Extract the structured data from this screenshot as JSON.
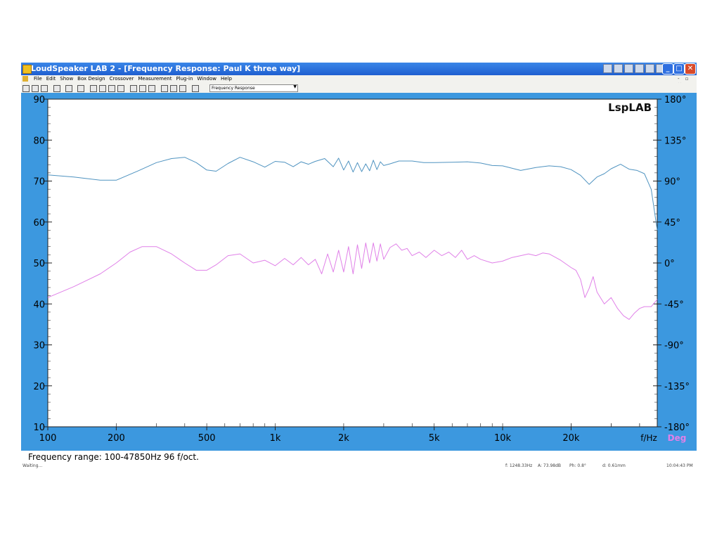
{
  "window": {
    "title": "LoudSpeaker LAB 2 - [Frequency Response: Paul K three way]",
    "controls": [
      "minimize-icon",
      "maximize-icon",
      "close-icon"
    ]
  },
  "menu": [
    "File",
    "Edit",
    "Show",
    "Box Design",
    "Crossover",
    "Measurement",
    "Plug-in",
    "Window",
    "Help"
  ],
  "toolbar": {
    "view_select": "Frequency Response"
  },
  "chart": {
    "watermark": "LspLAB",
    "xlabel": "f/Hz",
    "phase_unit_label": "Deg",
    "colors": {
      "frame": "#3c98df",
      "spl": "#4f93c0",
      "phase": "#e080e8"
    }
  },
  "chart_data": {
    "type": "line",
    "x_scale": "log",
    "xlim": [
      100,
      47850
    ],
    "x_ticks": [
      100,
      200,
      500,
      1000,
      2000,
      5000,
      10000,
      20000
    ],
    "x_tick_labels": [
      "100",
      "200",
      "500",
      "1k",
      "2k",
      "5k",
      "10k",
      "20k"
    ],
    "ylim": [
      10,
      90
    ],
    "y_ticks": [
      90,
      80,
      70,
      60,
      50,
      40,
      30,
      20,
      10
    ],
    "y_tick_labels": [
      "90",
      "80",
      "70",
      "60",
      "50",
      "40",
      "30",
      "20",
      "10"
    ],
    "y2lim": [
      -180,
      180
    ],
    "y2_ticks": [
      180,
      135,
      90,
      45,
      0,
      -45,
      -90,
      -135,
      -180
    ],
    "y2_tick_labels": [
      "180°",
      "135°",
      "90°",
      "45°",
      "0°",
      "-45°",
      "-90°",
      "-135°",
      "-180°"
    ],
    "series": [
      {
        "axis": "left",
        "x": [
          100,
          130,
          170,
          200,
          250,
          300,
          350,
          400,
          450,
          500,
          550,
          620,
          700,
          800,
          900,
          1000,
          1100,
          1200,
          1300,
          1400,
          1500,
          1650,
          1800,
          1900,
          2000,
          2100,
          2200,
          2300,
          2400,
          2500,
          2600,
          2700,
          2800,
          2900,
          3000,
          3200,
          3500,
          4000,
          4500,
          5000,
          6000,
          7000,
          8000,
          9000,
          10000,
          12000,
          14000,
          16000,
          18000,
          20000,
          22000,
          24000,
          26000,
          28000,
          30000,
          33000,
          36000,
          39000,
          42000,
          45000,
          47850
        ],
        "y": [
          71.5,
          71,
          70.2,
          70.2,
          72.5,
          74.5,
          75.5,
          75.8,
          74.5,
          72.7,
          72.4,
          74.3,
          75.8,
          74.7,
          73.4,
          74.8,
          74.6,
          73.5,
          74.7,
          74.1,
          74.8,
          75.5,
          73.5,
          75.6,
          72.7,
          74.9,
          72.2,
          74.5,
          72.3,
          74.2,
          72.5,
          75.1,
          72.8,
          74.7,
          73.8,
          74.2,
          74.9,
          74.9,
          74.5,
          74.5,
          74.6,
          74.7,
          74.4,
          73.8,
          73.7,
          72.6,
          73.3,
          73.7,
          73.5,
          72.8,
          71.4,
          69.2,
          71,
          71.8,
          73,
          74.1,
          72.9,
          72.6,
          71.8,
          68,
          58
        ]
      },
      {
        "axis": "right",
        "x": [
          100,
          130,
          170,
          200,
          230,
          260,
          300,
          350,
          400,
          450,
          500,
          550,
          620,
          700,
          800,
          900,
          1000,
          1100,
          1200,
          1300,
          1400,
          1500,
          1600,
          1700,
          1800,
          1900,
          2000,
          2100,
          2200,
          2300,
          2400,
          2500,
          2600,
          2700,
          2800,
          2900,
          3000,
          3200,
          3400,
          3600,
          3800,
          4000,
          4300,
          4600,
          5000,
          5400,
          5800,
          6200,
          6600,
          7000,
          7500,
          8000,
          9000,
          10000,
          11000,
          12000,
          13000,
          14000,
          15000,
          16000,
          18000,
          20000,
          21000,
          22000,
          23000,
          24000,
          25000,
          26000,
          28000,
          30000,
          32000,
          34000,
          36000,
          38000,
          40000,
          42000,
          45000,
          47850
        ],
        "y": [
          -38,
          -26,
          -12,
          0,
          12,
          18,
          18,
          10,
          0,
          -8,
          -8,
          -2,
          8,
          10,
          0,
          3,
          -3,
          5,
          -2,
          6,
          -2,
          4,
          -12,
          10,
          -10,
          14,
          -10,
          18,
          -12,
          20,
          -6,
          22,
          0,
          22,
          2,
          21,
          4,
          17,
          21,
          14,
          16,
          8,
          12,
          6,
          14,
          8,
          12,
          6,
          14,
          4,
          8,
          4,
          0,
          2,
          6,
          8,
          10,
          8,
          11,
          10,
          3,
          -5,
          -8,
          -18,
          -38,
          -28,
          -15,
          -32,
          -45,
          -38,
          -50,
          -58,
          -62,
          -55,
          -50,
          -48,
          -48,
          -40
        ]
      }
    ]
  },
  "status": {
    "frequency_range": "Frequency range: 100-47850Hz  96 f/oct.",
    "state": "Waiting...",
    "readout_f": "f: 1248.33Hz",
    "readout_a": "A: 73.98dB",
    "readout_ph": "Ph: 0.8°",
    "readout_d": "d: 0.61mm",
    "clock": "10:04:43 PM"
  }
}
